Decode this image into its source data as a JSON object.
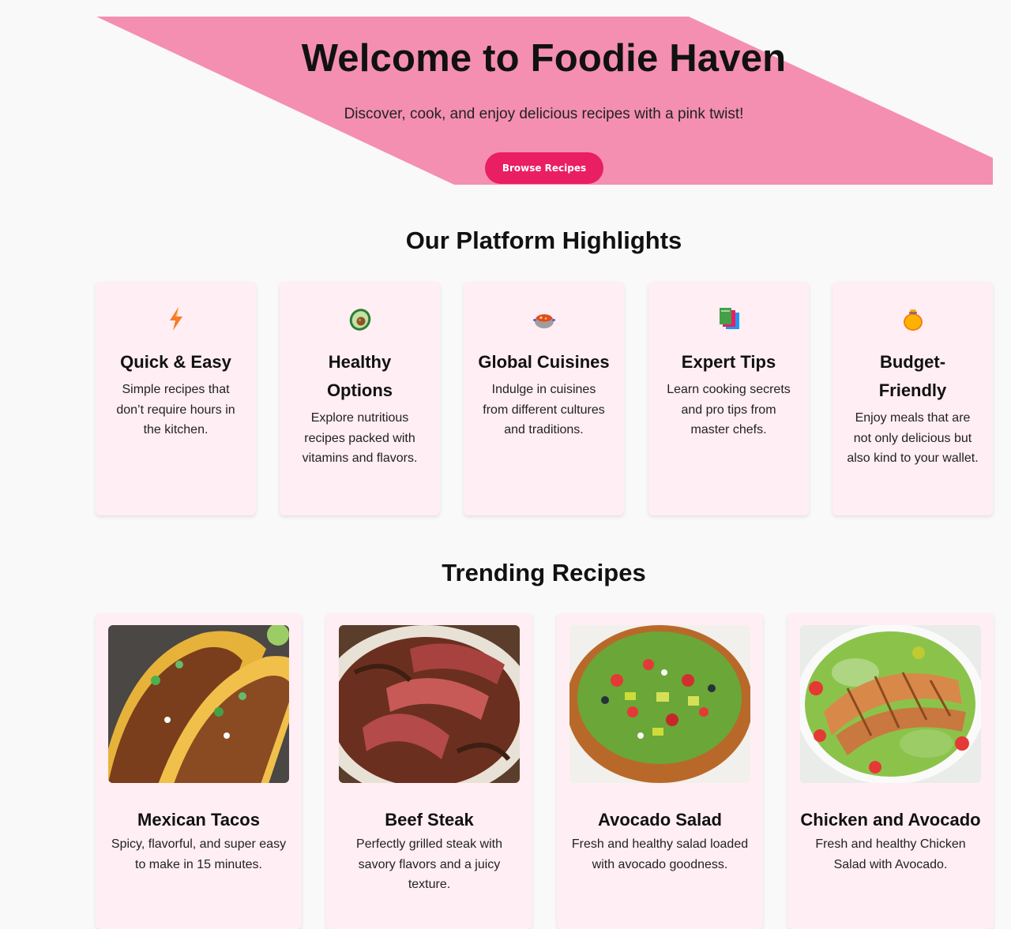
{
  "hero": {
    "title": "Welcome to Foodie Haven",
    "subtitle": "Discover, cook, and enjoy delicious recipes with a pink twist!",
    "button_label": "Browse Recipes"
  },
  "highlights": {
    "title": "Our Platform Highlights",
    "items": [
      {
        "icon": "lightning-icon",
        "title": "Quick & Easy",
        "text": "Simple recipes that don’t require hours in the kitchen."
      },
      {
        "icon": "avocado-icon",
        "title": "Healthy Options",
        "text": "Explore nutritious recipes packed with vitamins and flavors."
      },
      {
        "icon": "stew-pot-icon",
        "title": "Global Cuisines",
        "text": "Indulge in cuisines from different cultures and traditions."
      },
      {
        "icon": "books-icon",
        "title": "Expert Tips",
        "text": "Learn cooking secrets and pro tips from master chefs."
      },
      {
        "icon": "money-bag-icon",
        "title": "Budget-Friendly",
        "text": "Enjoy meals that are not only delicious but also kind to your wallet."
      }
    ]
  },
  "trending": {
    "title": "Trending Recipes",
    "items": [
      {
        "image": "tacos-photo",
        "title": "Mexican Tacos",
        "text": "Spicy, flavorful, and super easy to make in 15 minutes."
      },
      {
        "image": "steak-photo",
        "title": "Beef Steak",
        "text": "Perfectly grilled steak with savory flavors and a juicy texture."
      },
      {
        "image": "salad-photo",
        "title": "Avocado Salad",
        "text": "Fresh and healthy salad loaded with avocado goodness."
      },
      {
        "image": "chicken-salad-photo",
        "title": "Chicken and Avocado",
        "text": "Fresh and healthy Chicken Salad with Avocado."
      }
    ]
  },
  "colors": {
    "hero_background": "#f48fb1",
    "accent": "#e91e63",
    "card_background": "#ffeef3",
    "page_background": "#f9f9f9"
  }
}
